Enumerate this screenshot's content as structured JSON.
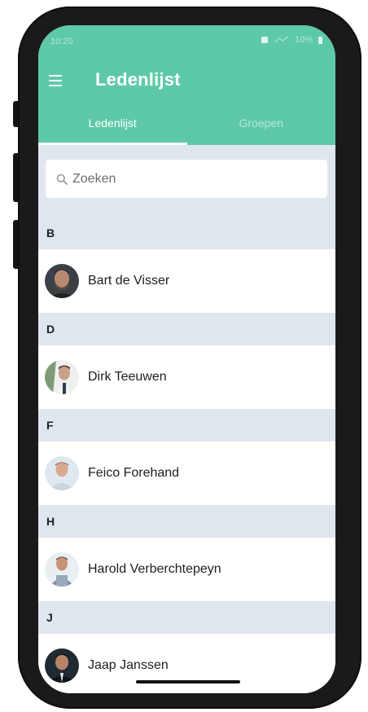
{
  "status": {
    "time": "10:20",
    "battery": "10%"
  },
  "appbar": {
    "title": "Ledenlijst"
  },
  "tabs": [
    {
      "label": "Ledenlijst"
    },
    {
      "label": "Groepen"
    }
  ],
  "search": {
    "placeholder": "Zoeken"
  },
  "sections": [
    {
      "letter": "B",
      "name": "Bart de Visser",
      "avatar_icon": "person-avatar"
    },
    {
      "letter": "D",
      "name": "Dirk Teeuwen",
      "avatar_icon": "person-avatar"
    },
    {
      "letter": "F",
      "name": "Feico Forehand",
      "avatar_icon": "person-avatar"
    },
    {
      "letter": "H",
      "name": "Harold Verberchtepeyn",
      "avatar_icon": "person-avatar"
    },
    {
      "letter": "J",
      "name": "Jaap Janssen",
      "avatar_icon": "person-avatar"
    }
  ],
  "colors": {
    "accent": "#5ec9a8",
    "background": "#dfe6ee"
  }
}
